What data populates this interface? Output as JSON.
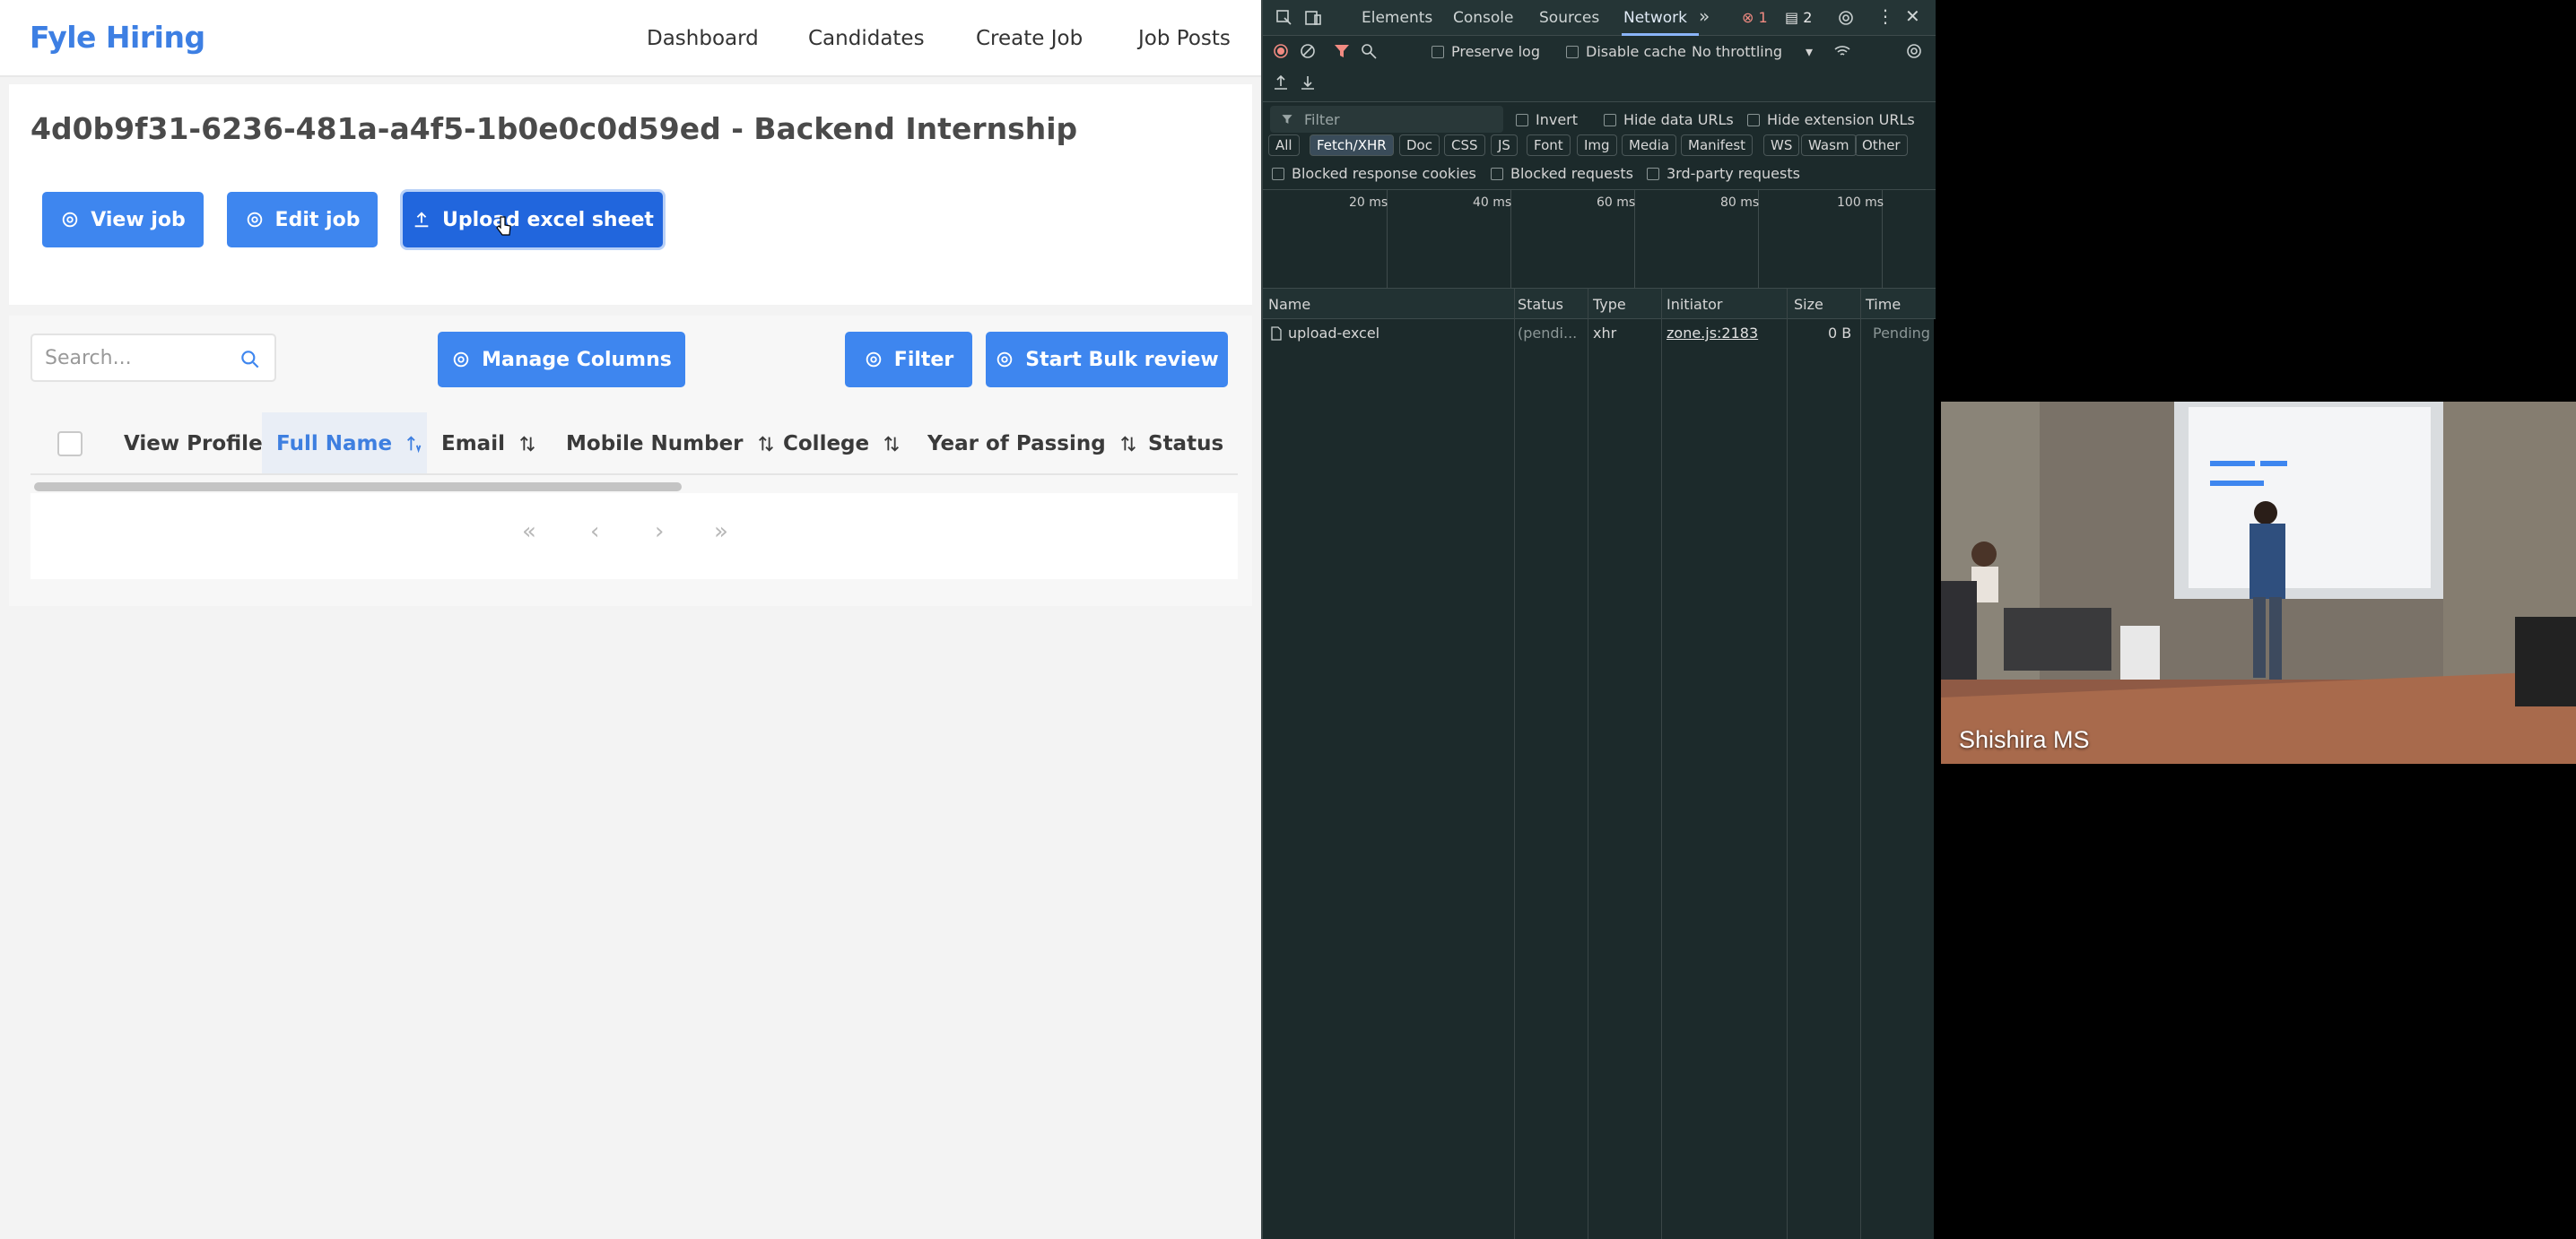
{
  "app": {
    "brand": "Fyle Hiring",
    "nav": [
      "Dashboard",
      "Candidates",
      "Create Job",
      "Job Posts"
    ],
    "job_title": "4d0b9f31-6236-481a-a4f5-1b0e0c0d59ed - Backend Internship",
    "actions": {
      "view_job": "View job",
      "edit_job": "Edit job",
      "upload_excel": "Upload excel sheet"
    },
    "search": {
      "placeholder": "Search..."
    },
    "toolbar": {
      "manage_columns": "Manage Columns",
      "filter": "Filter",
      "start_bulk_review": "Start Bulk review"
    },
    "columns": [
      "View Profile",
      "Full Name",
      "Email",
      "Mobile Number",
      "College",
      "Year of Passing",
      "Status"
    ],
    "sorted_column": "Full Name",
    "pagination": {
      "first": "«",
      "prev": "‹",
      "next": "›",
      "last": "»"
    }
  },
  "devtools": {
    "tabs": [
      "Elements",
      "Console",
      "Sources",
      "Network"
    ],
    "active_tab": "Network",
    "errors": "1",
    "messages": "2",
    "preserve_log": "Preserve log",
    "disable_cache": "Disable cache",
    "throttling": "No throttling",
    "filter_placeholder": "Filter",
    "invert": "Invert",
    "hide_data_urls": "Hide data URLs",
    "hide_extension_urls": "Hide extension URLs",
    "type_chips": [
      "All",
      "Fetch/XHR",
      "Doc",
      "CSS",
      "JS",
      "Font",
      "Img",
      "Media",
      "Manifest",
      "WS",
      "Wasm",
      "Other"
    ],
    "active_chip": "Fetch/XHR",
    "blocked_response_cookies": "Blocked response cookies",
    "blocked_requests": "Blocked requests",
    "third_party_requests": "3rd-party requests",
    "timeline_ticks": [
      "20 ms",
      "40 ms",
      "60 ms",
      "80 ms",
      "100 ms"
    ],
    "columns": [
      "Name",
      "Status",
      "Type",
      "Initiator",
      "Size",
      "Time"
    ],
    "requests": [
      {
        "name": "upload-excel",
        "status": "(pendi...",
        "type": "xhr",
        "initiator": "zone.js:2183",
        "size": "0 B",
        "time": "Pending"
      }
    ]
  },
  "video": {
    "participant": "Shishira MS"
  },
  "colors": {
    "primary": "#3e86ef",
    "brand": "#3d7fe3",
    "devtools_bg": "#1c2a2b",
    "accent_tab": "#8ab4f8"
  }
}
